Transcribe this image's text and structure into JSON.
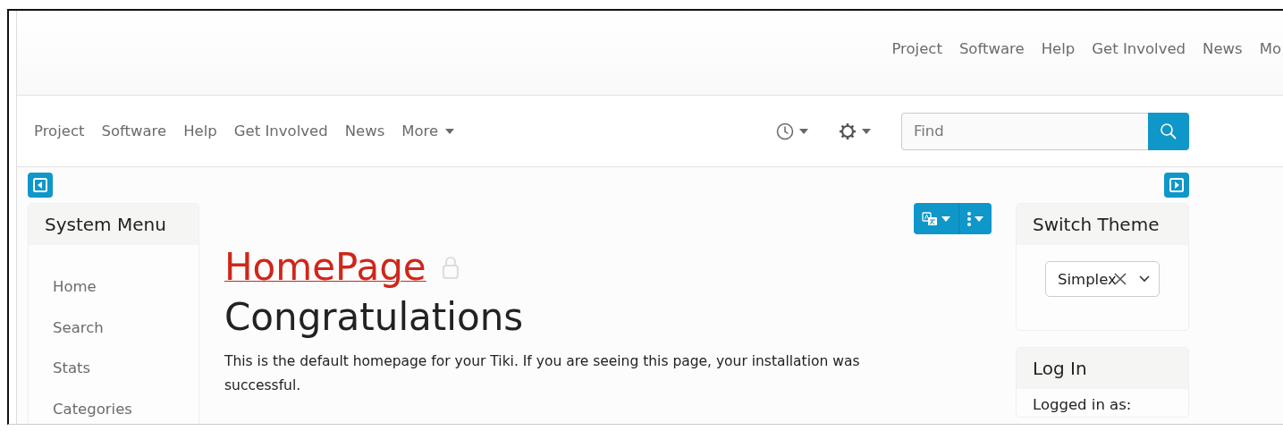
{
  "header_nav": [
    "Project",
    "Software",
    "Help",
    "Get Involved",
    "News",
    "Mo"
  ],
  "navbar": {
    "links": [
      "Project",
      "Software",
      "Help",
      "Get Involved",
      "News"
    ],
    "more": "More",
    "search": {
      "placeholder": "Find"
    }
  },
  "left_modules": [
    {
      "title": "System Menu",
      "items": [
        "Home",
        "Search",
        "Stats",
        "Categories"
      ]
    }
  ],
  "page": {
    "title": "HomePage",
    "locked": true,
    "heading": "Congratulations",
    "body": "This is the default homepage for your Tiki. If you are seeing this page, your installation was successful."
  },
  "right_modules": [
    {
      "title": "Switch Theme",
      "kind": "select",
      "value": "Simplex"
    },
    {
      "title": "Log In",
      "kind": "text",
      "text": "Logged in as:"
    }
  ]
}
